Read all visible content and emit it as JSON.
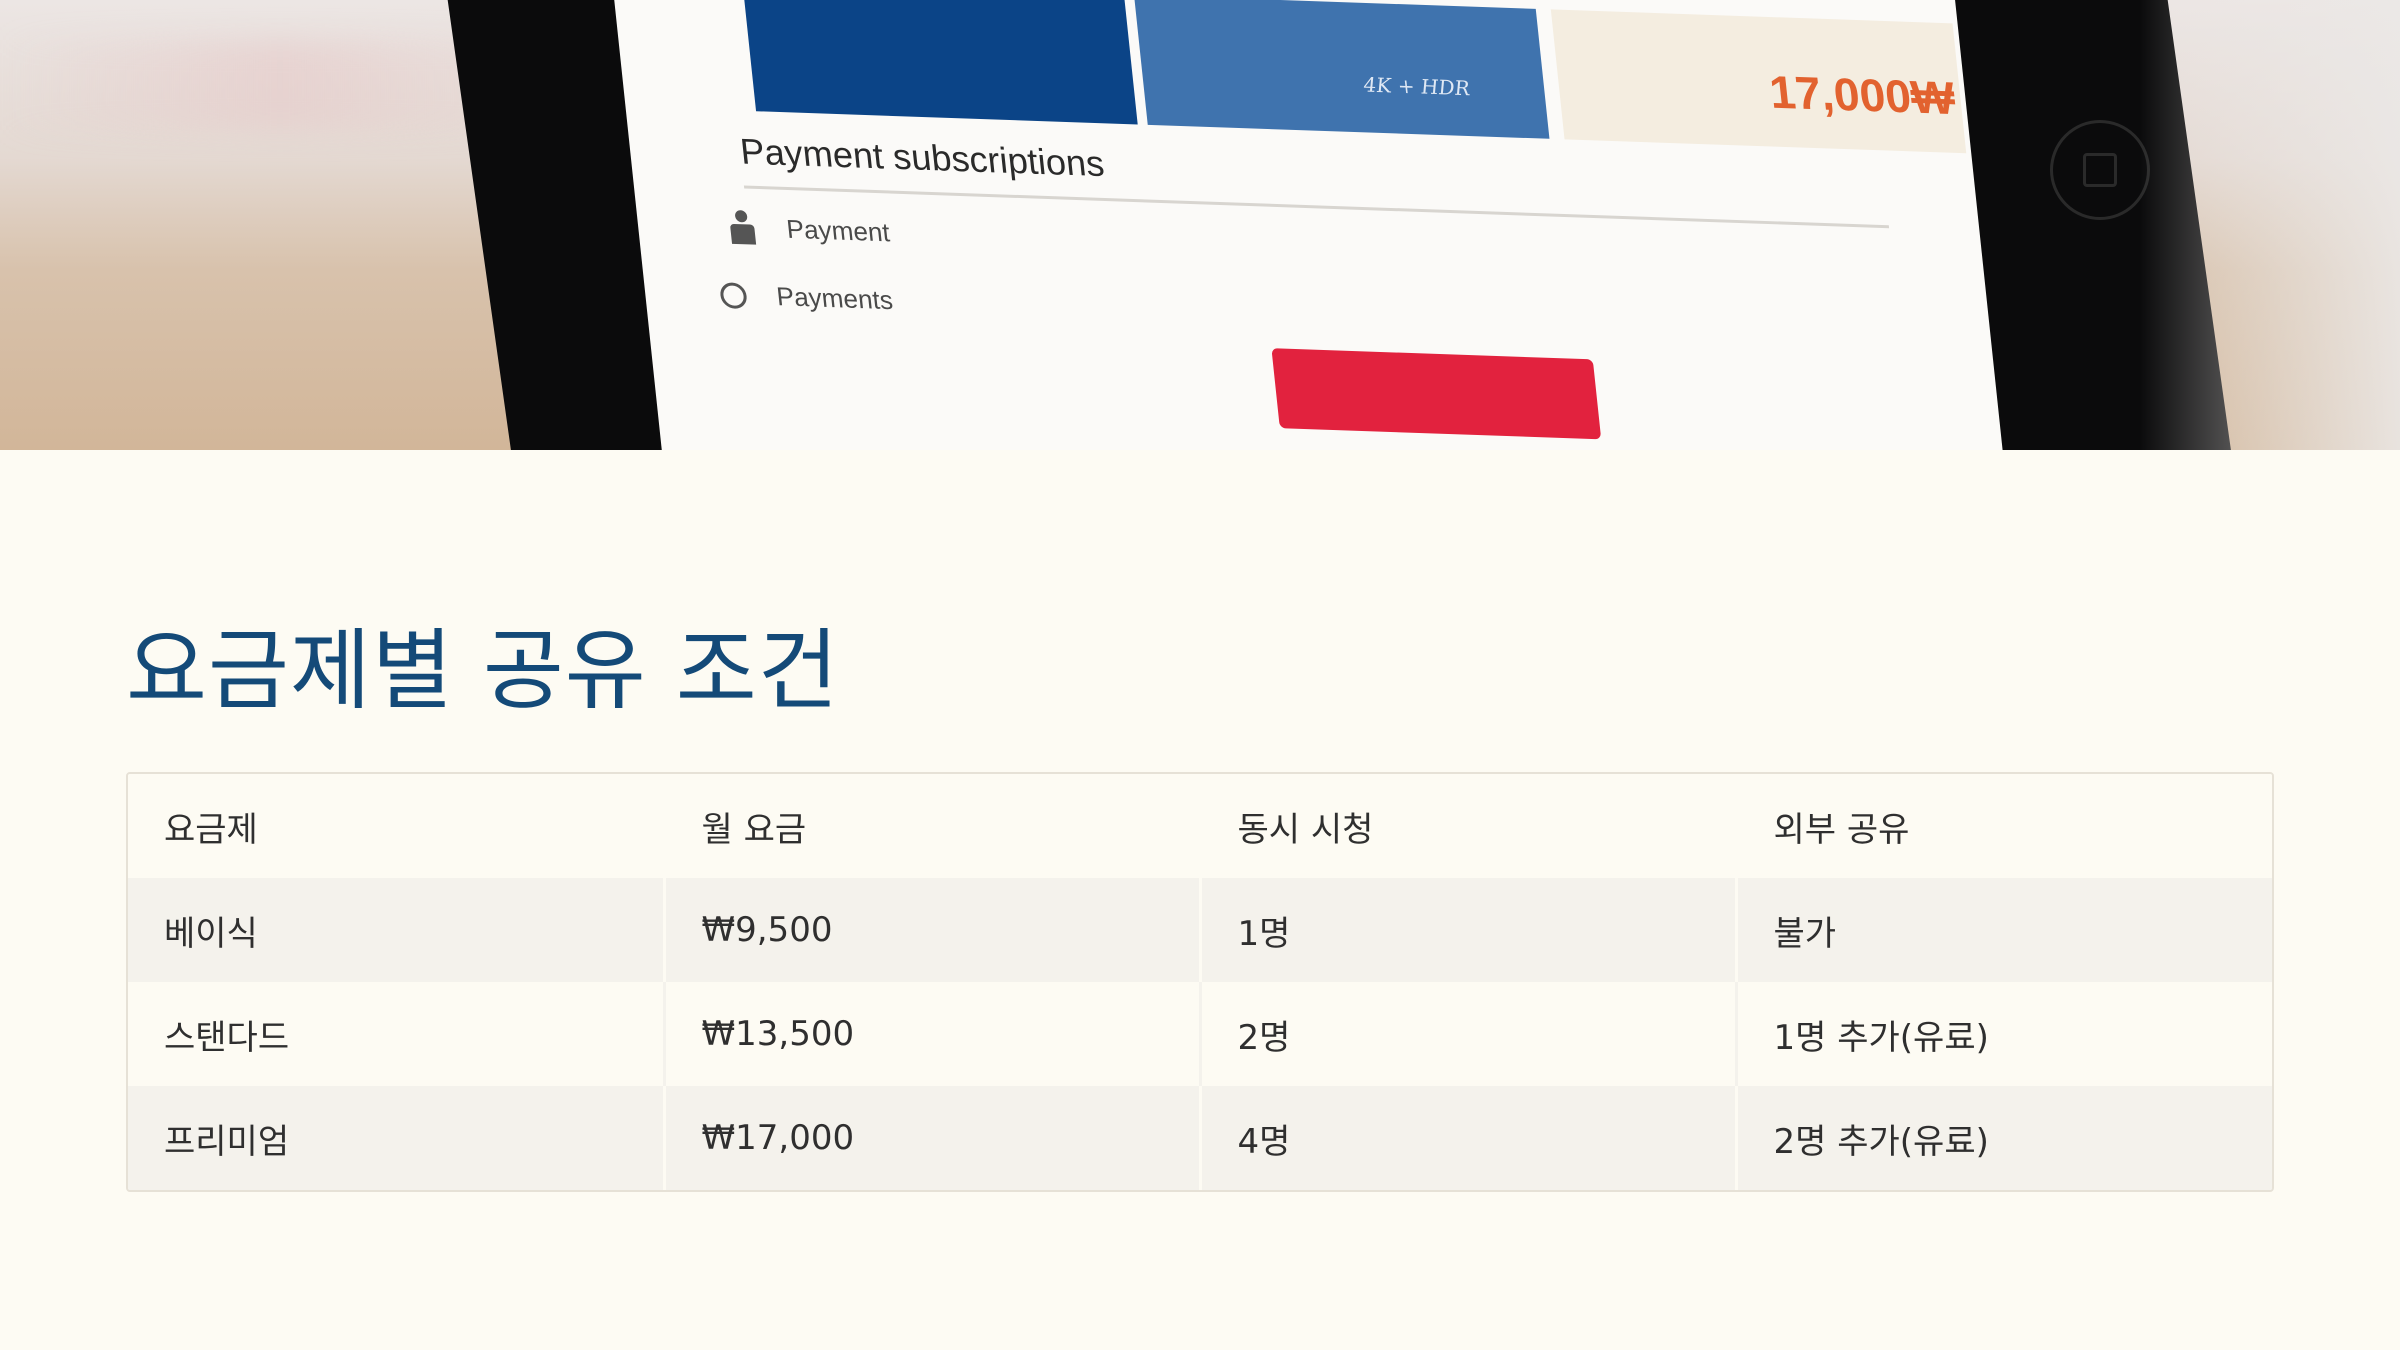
{
  "hero": {
    "tile_label": "4K + HDR",
    "tile_price": "17,000₩",
    "screen_heading": "Payment subscriptions",
    "rows": [
      {
        "label": "Payment",
        "icon": "person-icon"
      },
      {
        "label": "Payments",
        "icon": "radio-icon"
      }
    ],
    "colors": {
      "tile_dark_blue": "#0b4487",
      "tile_blue": "#3f73ae",
      "accent_red": "#e2223e",
      "price_orange": "#e2622f"
    }
  },
  "page": {
    "title": "요금제별 공유 조건"
  },
  "table": {
    "headers": [
      "요금제",
      "월 요금",
      "동시 시청",
      "외부 공유"
    ],
    "rows": [
      [
        "베이식",
        "₩9,500",
        "1명",
        "불가"
      ],
      [
        "스탠다드",
        "₩13,500",
        "2명",
        "1명 추가(유료)"
      ],
      [
        "프리미엄",
        "₩17,000",
        "4명",
        "2명 추가(유료)"
      ]
    ]
  },
  "colors": {
    "background": "#fdfbf3",
    "title": "#144a78",
    "row_stripe": "#f4f2ec",
    "border": "#e6e1d6"
  }
}
